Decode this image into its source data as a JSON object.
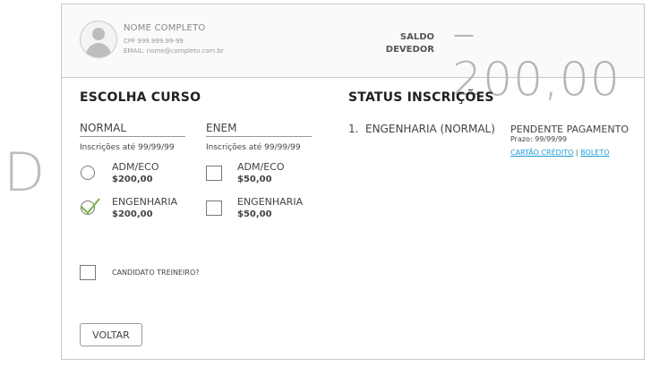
{
  "side_letter": "D",
  "user": {
    "name": "NOME COMPLETO",
    "cpf": "CPF 999.999.99-99",
    "email": "EMAIL: nome@completo.com.br"
  },
  "saldo": {
    "label_line1": "SALDO",
    "label_line2": "DEVEDOR",
    "value": "–200,00"
  },
  "escolha": {
    "title": "ESCOLHA CURSO",
    "columns": [
      {
        "heading": "NORMAL",
        "note": "Inscrições até 99/99/99",
        "control": "radio",
        "options": [
          {
            "name": "ADM/ECO",
            "price": "$200,00",
            "selected": false
          },
          {
            "name": "ENGENHARIA",
            "price": "$200,00",
            "selected": true
          }
        ]
      },
      {
        "heading": "ENEM",
        "note": "Inscrições até 99/99/99",
        "control": "checkbox",
        "options": [
          {
            "name": "ADM/ECO",
            "price": "$50,00",
            "selected": false
          },
          {
            "name": "ENGENHARIA",
            "price": "$50,00",
            "selected": false
          }
        ]
      }
    ],
    "treineiro_label": "CANDIDATO TREINEIRO?",
    "treineiro_checked": false,
    "back_label": "VOLTAR"
  },
  "status": {
    "title": "STATUS INSCRIÇÕES",
    "items": [
      {
        "number": "1.",
        "course": "ENGENHARIA (NORMAL)",
        "state": "PENDENTE PAGAMENTO",
        "deadline": "Prazo: 99/99/99",
        "link_card": "CARTÃO CRÉDITO",
        "separator": "|",
        "link_boleto": "BOLETO"
      }
    ]
  },
  "colors": {
    "accent_link": "#1a9bd7",
    "check_green": "#7cb342",
    "saldo_gray": "#b5b5b5"
  }
}
